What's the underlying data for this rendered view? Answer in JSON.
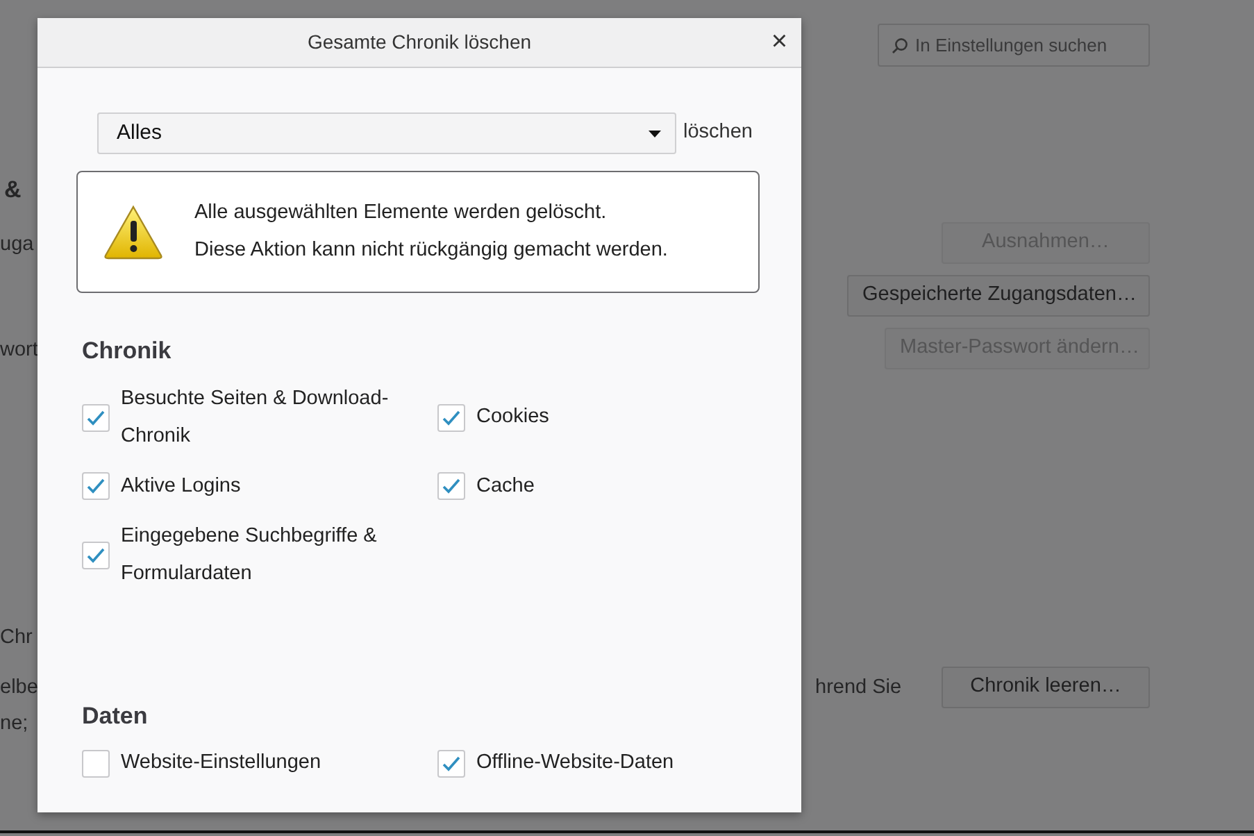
{
  "page": {
    "search": {
      "placeholder": "In Einstellungen suchen"
    },
    "fragments": [
      {
        "text": "&",
        "kind": "heading"
      },
      {
        "text": "uga",
        "kind": "text"
      },
      {
        "text": "wort",
        "kind": "text"
      },
      {
        "text": "Chr",
        "kind": "text"
      },
      {
        "text": "elbe",
        "kind": "text"
      },
      {
        "text": "ne;",
        "kind": "text"
      },
      {
        "text": "hrend Sie",
        "kind": "text"
      }
    ],
    "buttons": [
      {
        "label": "Ausnahmen…",
        "disabled": true
      },
      {
        "label": "Gespeicherte Zugangsdaten…",
        "disabled": false
      },
      {
        "label": "Master-Passwort ändern…",
        "disabled": true
      },
      {
        "label": "Chronik leeren…",
        "disabled": false
      }
    ]
  },
  "dialog": {
    "title": "Gesamte Chronik löschen",
    "close": "×",
    "range": {
      "value": "Alles",
      "suffix": "löschen"
    },
    "warning": [
      "Alle ausgewählten Elemente werden gelöscht.",
      "Diese Aktion kann nicht rückgängig gemacht werden."
    ],
    "sections": [
      {
        "title": "Chronik",
        "items": [
          {
            "label": "Besuchte Seiten & Download-Chronik",
            "checked": true
          },
          {
            "label": "Cookies",
            "checked": true
          },
          {
            "label": "Aktive Logins",
            "checked": true
          },
          {
            "label": "Cache",
            "checked": true
          },
          {
            "label": "Eingegebene Suchbegriffe & Formulardaten",
            "checked": true
          }
        ]
      },
      {
        "title": "Daten",
        "items": [
          {
            "label": "Website-Einstellungen",
            "checked": false
          },
          {
            "label": "Offline-Website-Daten",
            "checked": true
          }
        ]
      }
    ]
  }
}
